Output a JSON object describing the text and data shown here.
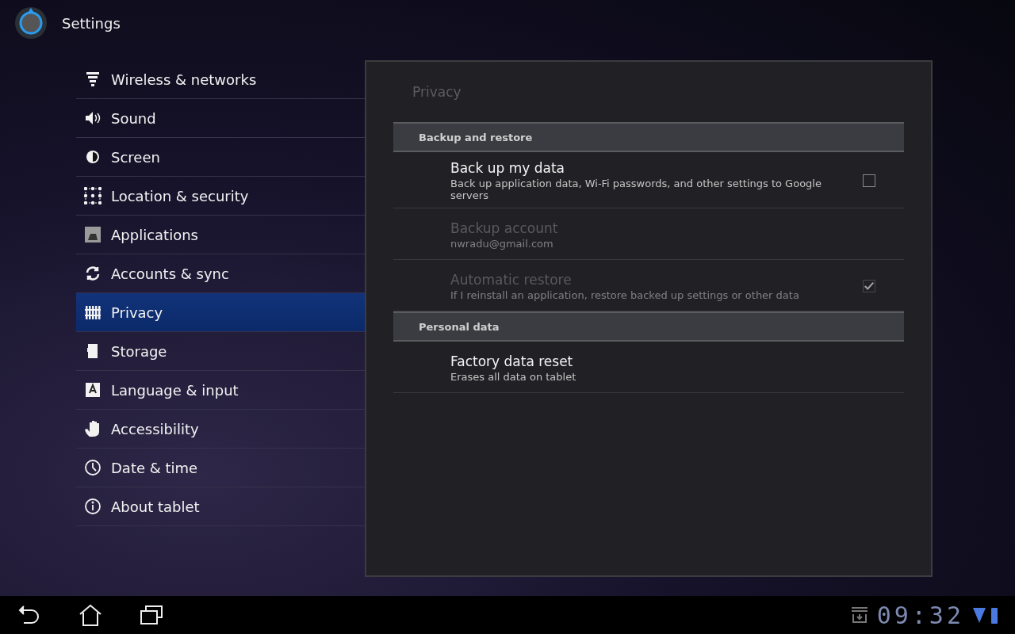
{
  "action_bar": {
    "title": "Settings"
  },
  "sidebar": {
    "items": [
      {
        "label": "Wireless & networks",
        "selected": false
      },
      {
        "label": "Sound",
        "selected": false
      },
      {
        "label": "Screen",
        "selected": false
      },
      {
        "label": "Location & security",
        "selected": false
      },
      {
        "label": "Applications",
        "selected": false
      },
      {
        "label": "Accounts & sync",
        "selected": false
      },
      {
        "label": "Privacy",
        "selected": true
      },
      {
        "label": "Storage",
        "selected": false
      },
      {
        "label": "Language & input",
        "selected": false
      },
      {
        "label": "Accessibility",
        "selected": false
      },
      {
        "label": "Date & time",
        "selected": false
      },
      {
        "label": "About tablet",
        "selected": false
      }
    ]
  },
  "panel": {
    "title": "Privacy",
    "sections": [
      {
        "header": "Backup and restore",
        "items": [
          {
            "kind": "checkbox",
            "title": "Back up my data",
            "summary": "Back up application data, Wi-Fi passwords, and other settings to Google servers",
            "disabled": false,
            "checked": false
          },
          {
            "kind": "plain",
            "title": "Backup account",
            "summary": "nwradu@gmail.com",
            "disabled": true
          },
          {
            "kind": "checkbox",
            "title": "Automatic restore",
            "summary": "If I reinstall an application, restore backed up settings or other data",
            "disabled": true,
            "checked": true
          }
        ]
      },
      {
        "header": "Personal data",
        "items": [
          {
            "kind": "plain",
            "title": "Factory data reset",
            "summary": "Erases all data on tablet",
            "disabled": false
          }
        ]
      }
    ]
  },
  "system_bar": {
    "clock": "09:32"
  }
}
